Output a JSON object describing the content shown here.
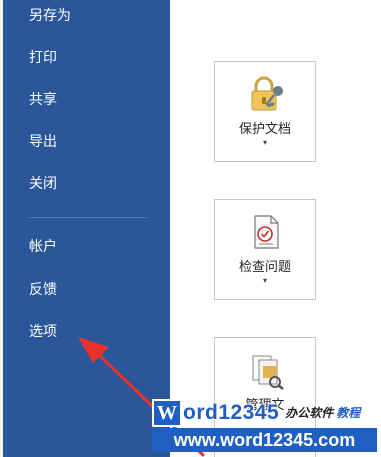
{
  "nav": {
    "items": [
      {
        "label": "另存为"
      },
      {
        "label": "打印"
      },
      {
        "label": "共享"
      },
      {
        "label": "导出"
      },
      {
        "label": "关闭"
      }
    ],
    "items2": [
      {
        "label": "帐户"
      },
      {
        "label": "反馈"
      },
      {
        "label": "选项"
      }
    ],
    "bg_color": "#2b579a"
  },
  "content": {
    "buttons": [
      {
        "label": "保护文档",
        "icon": "lock-key-icon",
        "caret": "▾"
      },
      {
        "label": "检查问题",
        "icon": "document-check-icon",
        "caret": "▾"
      },
      {
        "label": "管理文",
        "icon": "manage-documents-icon"
      }
    ]
  },
  "annotation": {
    "arrow_color": "#e8322a",
    "points_to": "选项"
  },
  "watermark": {
    "logo_w": "W",
    "logo_rest": "ord12345",
    "tagline_1": "办公软件",
    "tagline_2": "教程",
    "url": "www.word12345.com",
    "brand_color": "#1f5fc2"
  }
}
